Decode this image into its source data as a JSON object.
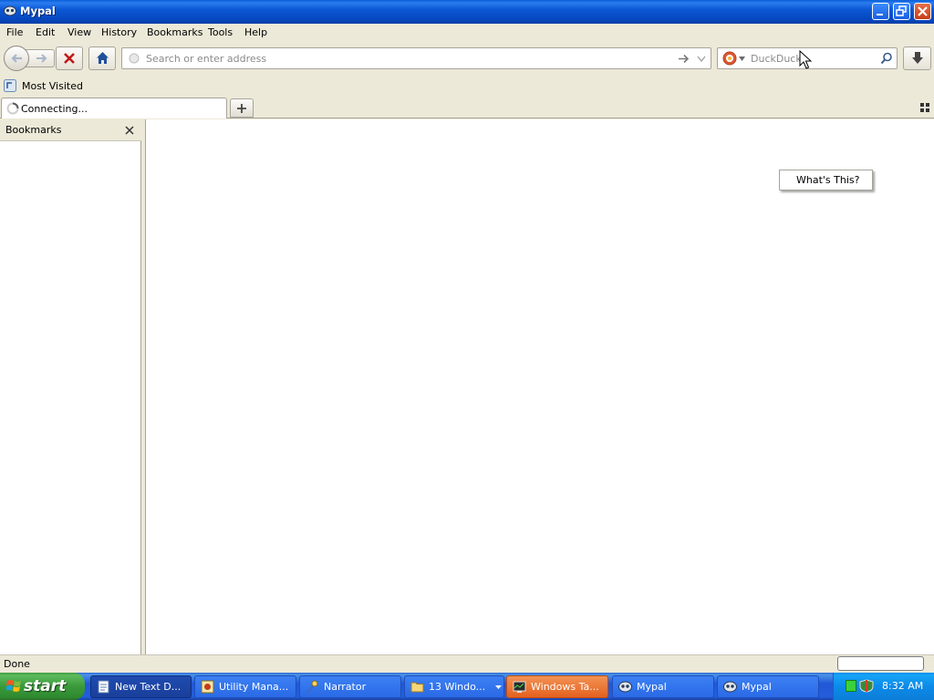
{
  "window": {
    "title": "Mypal"
  },
  "menu": {
    "items": [
      "File",
      "Edit",
      "View",
      "History",
      "Bookmarks",
      "Tools",
      "Help"
    ]
  },
  "navbar": {
    "url_placeholder": "Search or enter address",
    "search_placeholder": "DuckDuck"
  },
  "bookmarks_toolbar": {
    "items": [
      {
        "label": "Most Visited"
      }
    ]
  },
  "tabs": [
    {
      "label": "Connecting..."
    }
  ],
  "sidebar": {
    "title": "Bookmarks"
  },
  "context_menu": {
    "items": [
      "What's This?"
    ]
  },
  "statusbar": {
    "text": "Done"
  },
  "taskbar": {
    "start_label": "start",
    "tasks": [
      {
        "label": "New Text D...",
        "state": "active"
      },
      {
        "label": "Utility Mana...",
        "state": "normal"
      },
      {
        "label": "Narrator",
        "state": "normal"
      },
      {
        "label": "13 Windo...",
        "state": "normal"
      },
      {
        "label": "Windows Ta...",
        "state": "flash"
      },
      {
        "label": "Mypal",
        "state": "normal"
      },
      {
        "label": "Mypal",
        "state": "normal"
      }
    ],
    "clock": "8:32 AM"
  },
  "colors": {
    "title_bar": "#0a5fd8",
    "taskbar": "#245edb",
    "start_button": "#3a9a3a",
    "tray": "#0d8ae8",
    "flash_task": "#e4611e"
  }
}
